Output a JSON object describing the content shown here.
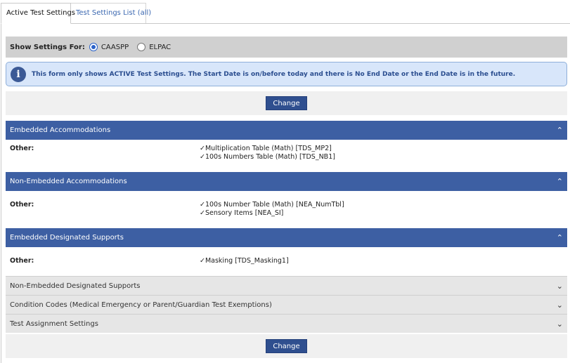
{
  "tabs": [
    {
      "label": "Active Test Settings"
    },
    {
      "label": "Test Settings List (all)"
    }
  ],
  "filter": {
    "label": "Show Settings For:",
    "options": [
      {
        "label": "CAASPP",
        "selected": true
      },
      {
        "label": "ELPAC",
        "selected": false
      }
    ]
  },
  "info": {
    "icon": "info-icon",
    "text": "This form only shows ACTIVE Test Settings.  The Start Date is on/before today and there is No End Date or the End Date is in the future."
  },
  "change_label": "Change",
  "sections": [
    {
      "title": "Embedded Accommodations",
      "expanded": true,
      "row_label": "Other:",
      "items": [
        "✓Multiplication Table (Math) [TDS_MP2]",
        "✓100s Numbers Table (Math) [TDS_NB1]"
      ]
    },
    {
      "title": "Non-Embedded Accommodations",
      "expanded": true,
      "row_label": "Other:",
      "items": [
        "✓100s Number Table (Math) [NEA_NumTbl]",
        "✓Sensory Items [NEA_SI]"
      ]
    },
    {
      "title": "Embedded Designated Supports",
      "expanded": true,
      "row_label": "Other:",
      "items": [
        "✓Masking [TDS_Masking1]"
      ]
    }
  ],
  "collapsed_sections": [
    {
      "title": "Non-Embedded Designated Supports"
    },
    {
      "title": "Condition Codes (Medical Emergency or Parent/Guardian Test Exemptions)"
    },
    {
      "title": "Test Assignment Settings"
    }
  ],
  "colors": {
    "section_header": "#3d5fa3",
    "button": "#2f4f8f",
    "info_bg": "#d8e6fa"
  }
}
